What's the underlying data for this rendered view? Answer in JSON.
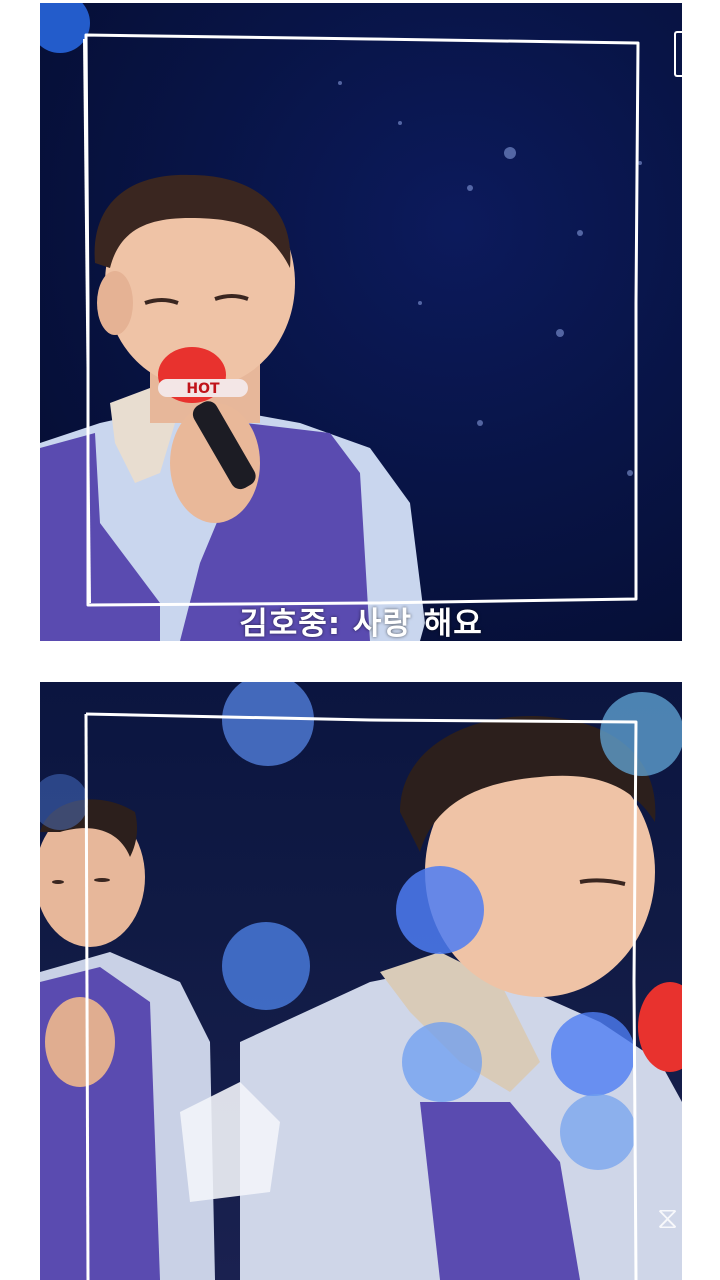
{
  "top_video": {
    "caption": "김호중: 사랑 해요",
    "mic_label": "HOT"
  },
  "bottom_video": {
    "watermark_icon": "capcut-logo-icon"
  },
  "colors": {
    "stage_blue": "#081446",
    "vest_purple": "#5a4bb0",
    "shirt_blue": "#c9d6ee",
    "bokeh_blue": "#5b8df0",
    "mic_red": "#e8322e"
  }
}
